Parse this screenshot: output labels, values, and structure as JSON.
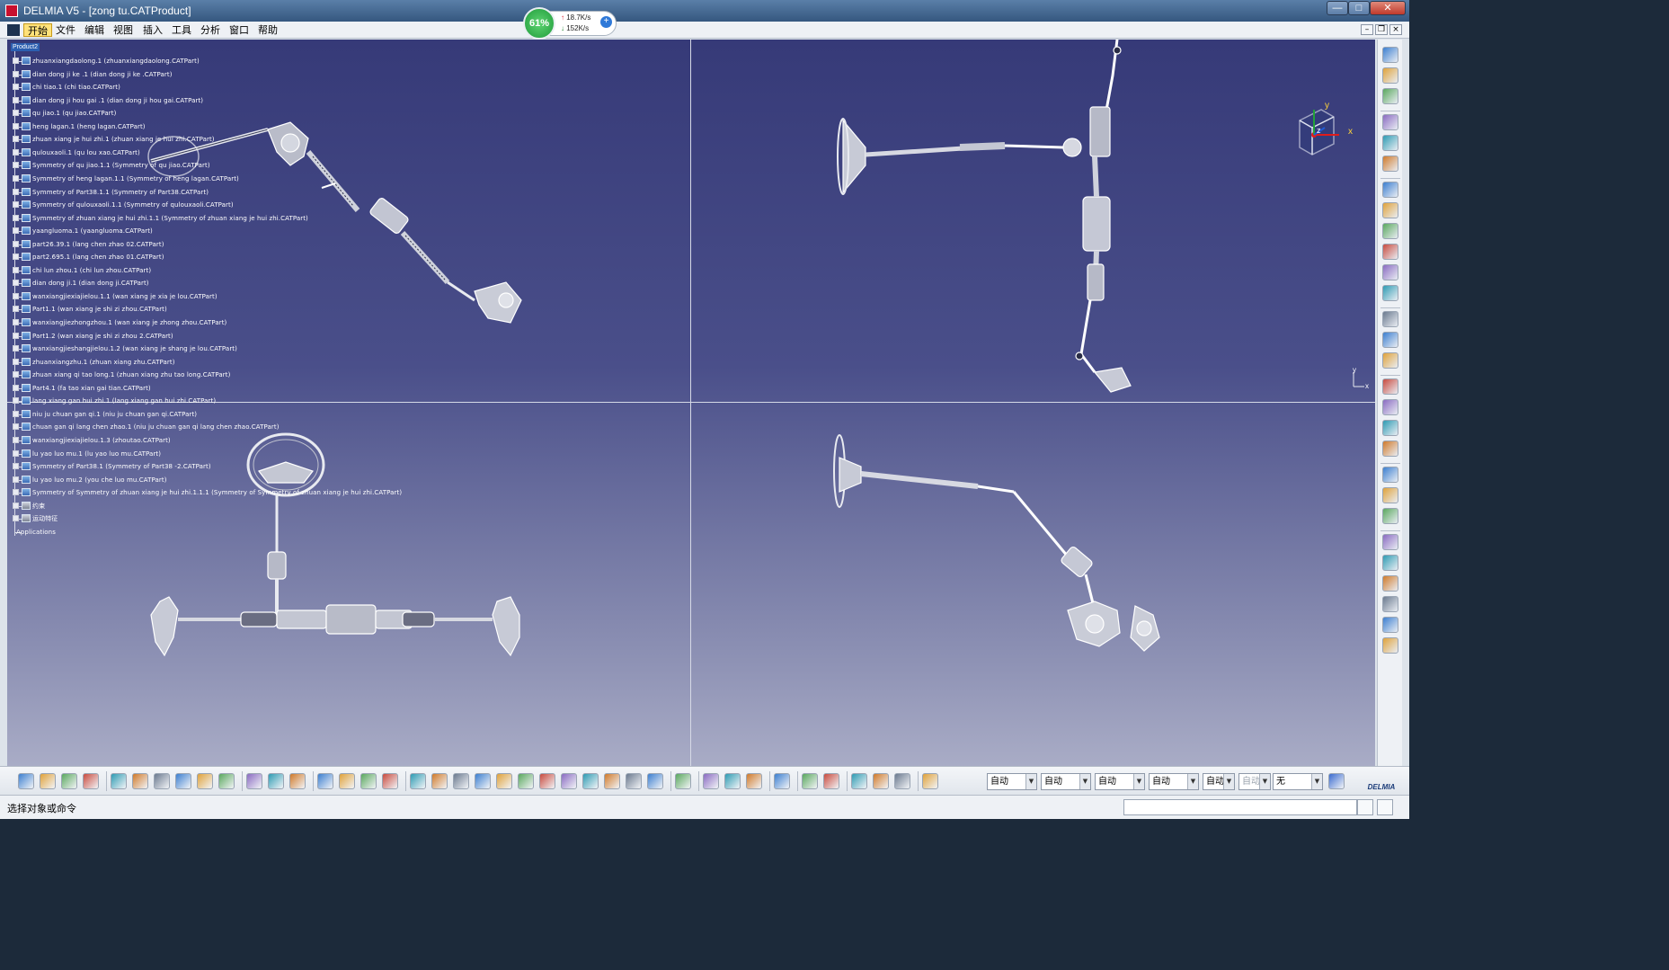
{
  "window": {
    "title": "DELMIA V5 - [zong tu.CATProduct]",
    "controls": {
      "minimize": "—",
      "maximize": "□",
      "close": "✕"
    }
  },
  "menubar": {
    "items": [
      "开始",
      "文件",
      "编辑",
      "视图",
      "插入",
      "工具",
      "分析",
      "窗口",
      "帮助"
    ],
    "active_index": 0,
    "mdi_controls": {
      "minimize": "–",
      "restore": "❐",
      "close": "×"
    }
  },
  "net_widget": {
    "percent": "61%",
    "up_speed": "18.7K/s",
    "down_speed": "152K/s",
    "up_arrow": "↑",
    "down_arrow": "↓",
    "plus": "+"
  },
  "tree": {
    "root": "Product2",
    "items": [
      "zhuanxiangdaolong.1 (zhuanxiangdaolong.CATPart)",
      "dian dong ji ke .1 (dian dong ji ke .CATPart)",
      "chi tiao.1 (chi tiao.CATPart)",
      "dian dong ji hou gai .1 (dian dong ji hou gai.CATPart)",
      "qu jiao.1 (qu jiao.CATPart)",
      "heng lagan.1 (heng lagan.CATPart)",
      "zhuan xiang je hui zhi.1 (zhuan xiang je hui zhi.CATPart)",
      "qulouxaoli.1 (qu lou xao.CATPart)",
      "Symmetry of qu jiao.1.1 (Symmetry of qu jiao.CATPart)",
      "Symmetry of heng lagan.1.1 (Symmetry of heng lagan.CATPart)",
      "Symmetry of Part38.1.1 (Symmetry of Part38.CATPart)",
      "Symmetry of qulouxaoli.1.1 (Symmetry of qulouxaoli.CATPart)",
      "Symmetry of zhuan xiang je hui zhi.1.1 (Symmetry of zhuan xiang je hui zhi.CATPart)",
      "yaangluoma.1 (yaangluoma.CATPart)",
      "part26.39.1 (lang chen zhao 02.CATPart)",
      "part2.695.1 (lang chen zhao 01.CATPart)",
      "chi lun zhou.1 (chi lun zhou.CATPart)",
      "dian dong ji.1 (dian dong ji.CATPart)",
      "wanxiangjiexiajielou.1.1 (wan xiang je xia je lou.CATPart)",
      "Part1.1 (wan xiang je shi zi zhou.CATPart)",
      "wanxiangjiezhongzhou.1 (wan xiang je zhong zhou.CATPart)",
      "Part1.2 (wan xiang je shi zi zhou 2.CATPart)",
      "wanxiangjieshangjielou.1.2 (wan xiang je shang je lou.CATPart)",
      "zhuanxiangzhu.1 (zhuan xiang zhu.CATPart)",
      "zhuan xiang qi tao long.1 (zhuan xiang zhu tao long.CATPart)",
      "Part4.1 (fa tao xian gai tian.CATPart)",
      "lang xiang gan hui zhi.1 (lang xiang gan hui zhi.CATPart)",
      "niu ju chuan gan qi.1 (niu ju chuan gan qi.CATPart)",
      "chuan gan qi lang chen zhao.1 (niu ju chuan gan qi lang chen zhao.CATPart)",
      "wanxiangjiexiajielou.1.3 (zhoutao.CATPart)",
      "lu yao luo mu.1 (lu yao luo mu.CATPart)",
      "Symmetry of Part38.1 (Symmetry of Part38 -2.CATPart)",
      "lu yao luo mu.2 (you che luo mu.CATPart)",
      "Symmetry of Symmetry of zhuan xiang je hui zhi.1.1.1 (Symmetry of Symmetry of zhuan xiang je hui zhi.CATPart)",
      "约束",
      "运动特征",
      "Applications"
    ]
  },
  "compass": {
    "x_label": "x",
    "y_label": "y",
    "z_label": "z"
  },
  "axis_triad": {
    "x_label": "x",
    "y_label": "y"
  },
  "right_toolbar": {
    "icons": [
      "gear-cluster-icon",
      "select-arrow-icon",
      "manipulate-icon",
      "sep",
      "assembly-constraint-icon",
      "fix-component-icon",
      "gear-icon",
      "sep",
      "joint-icon",
      "move-component-icon",
      "snap-icon",
      "exploded-view-icon",
      "clash-analysis-icon",
      "bom-icon",
      "sep",
      "catalog-icon",
      "mechanism-icon",
      "simulation-icon",
      "sep",
      "dress-up-icon",
      "kinematics-icon",
      "joint-revolute-icon",
      "joint-prismatic-icon",
      "sep",
      "sensor-icon",
      "law-icon",
      "command-icon",
      "sep",
      "analysis-icon",
      "sweep-icon",
      "distance-icon",
      "replay-icon",
      "speed-accel-icon",
      "trace-icon"
    ]
  },
  "bottom_toolbar": {
    "icons": [
      "new-icon",
      "open-icon",
      "save-icon",
      "print-icon",
      "sep",
      "cut-icon",
      "copy-icon",
      "paste-icon",
      "undo-icon",
      "redo-icon",
      "whats-this-icon",
      "sep",
      "formula-icon",
      "speech-bubble-icon",
      "light-icon",
      "sep",
      "table-icon",
      "tree-icon",
      "catalog-browser-icon",
      "measure-icon",
      "sep",
      "fly-icon",
      "fit-all-icon",
      "pan-icon",
      "rotate-icon",
      "zoom-in-icon",
      "zoom-out-icon",
      "normal-view-icon",
      "iso-view-icon",
      "cube-view-icon",
      "shading-icon",
      "hide-show-icon",
      "swap-visible-icon",
      "sep",
      "update-icon",
      "sep",
      "measure-between-icon",
      "measure-item-icon",
      "measure-inertia-icon",
      "sep",
      "sectioning-icon",
      "sep",
      "clash-icon",
      "distance-band-icon",
      "sep",
      "material-icon",
      "apply-material-icon",
      "render-icon",
      "sep",
      "grid-snap-icon"
    ],
    "combos": [
      {
        "value": "自动",
        "enabled": true
      },
      {
        "value": "自动",
        "enabled": true
      },
      {
        "value": "自动",
        "enabled": true
      },
      {
        "value": "自动",
        "enabled": true
      },
      {
        "value": "自动",
        "enabled": true
      },
      {
        "value": "自动",
        "enabled": false
      },
      {
        "value": "无",
        "enabled": true
      }
    ],
    "logo_text": "DELMIA"
  },
  "statusbar": {
    "text": "选择对象或命令",
    "command_value": ""
  },
  "colors": {
    "viewport_top": "#363a78",
    "viewport_bottom": "#a9acc6",
    "selection": "#2c5fb0",
    "compass_axis_x": "#e01b1b",
    "compass_axis_y": "#23a23a",
    "compass_axis_z": "#1f5bd6"
  }
}
